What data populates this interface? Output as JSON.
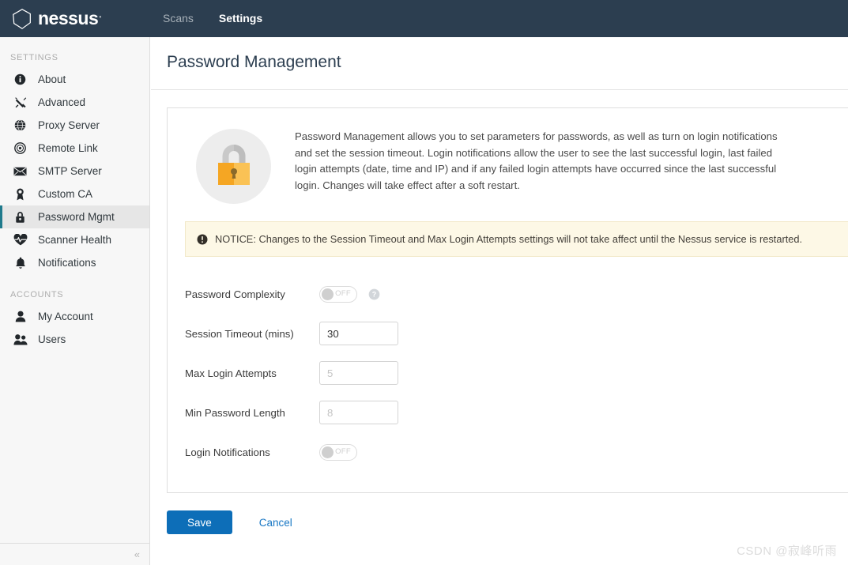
{
  "topbar": {
    "brand": "nessus",
    "brand_tm": "®",
    "nav": [
      {
        "label": "Scans",
        "active": false
      },
      {
        "label": "Settings",
        "active": true
      }
    ]
  },
  "sidebar": {
    "groups": [
      {
        "title": "SETTINGS",
        "items": [
          {
            "label": "About",
            "icon": "info-icon",
            "active": false
          },
          {
            "label": "Advanced",
            "icon": "tools-icon",
            "active": false
          },
          {
            "label": "Proxy Server",
            "icon": "globe-icon",
            "active": false
          },
          {
            "label": "Remote Link",
            "icon": "target-icon",
            "active": false
          },
          {
            "label": "SMTP Server",
            "icon": "envelope-icon",
            "active": false
          },
          {
            "label": "Custom CA",
            "icon": "certificate-icon",
            "active": false
          },
          {
            "label": "Password Mgmt",
            "icon": "lock-icon",
            "active": true
          },
          {
            "label": "Scanner Health",
            "icon": "heartbeat-icon",
            "active": false
          },
          {
            "label": "Notifications",
            "icon": "bell-icon",
            "active": false
          }
        ]
      },
      {
        "title": "ACCOUNTS",
        "items": [
          {
            "label": "My Account",
            "icon": "user-icon",
            "active": false
          },
          {
            "label": "Users",
            "icon": "users-icon",
            "active": false
          }
        ]
      }
    ],
    "collapse_glyph": "«"
  },
  "page": {
    "title": "Password Management",
    "intro": "Password Management allows you to set parameters for passwords, as well as turn on login notifications and set the session timeout. Login notifications allow the user to see the last successful login, last failed login attempts (date, time and IP) and if any failed login attempts have occurred since the last successful login. Changes will take effect after a soft restart.",
    "notice": "NOTICE: Changes to the Session Timeout and Max Login Attempts settings will not take affect until the Nessus service is restarted."
  },
  "form": {
    "fields": [
      {
        "label": "Password Complexity",
        "type": "toggle",
        "state": "OFF",
        "has_help": true
      },
      {
        "label": "Session Timeout (mins)",
        "type": "text",
        "value": "30",
        "placeholder": ""
      },
      {
        "label": "Max Login Attempts",
        "type": "text",
        "value": "",
        "placeholder": "5"
      },
      {
        "label": "Min Password Length",
        "type": "text",
        "value": "",
        "placeholder": "8"
      },
      {
        "label": "Login Notifications",
        "type": "toggle",
        "state": "OFF",
        "has_help": false
      }
    ]
  },
  "actions": {
    "save_label": "Save",
    "cancel_label": "Cancel"
  },
  "watermark": "CSDN @寂峰听雨",
  "colors": {
    "topbar_bg": "#2c3e50",
    "sidebar_bg": "#f7f7f7",
    "active_accent": "#1f7a8c",
    "primary_button": "#0d6eb8",
    "link": "#1877c4",
    "notice_bg": "#fdf8e6",
    "lock_body": "#f5a623",
    "lock_body_light": "#fac255"
  }
}
